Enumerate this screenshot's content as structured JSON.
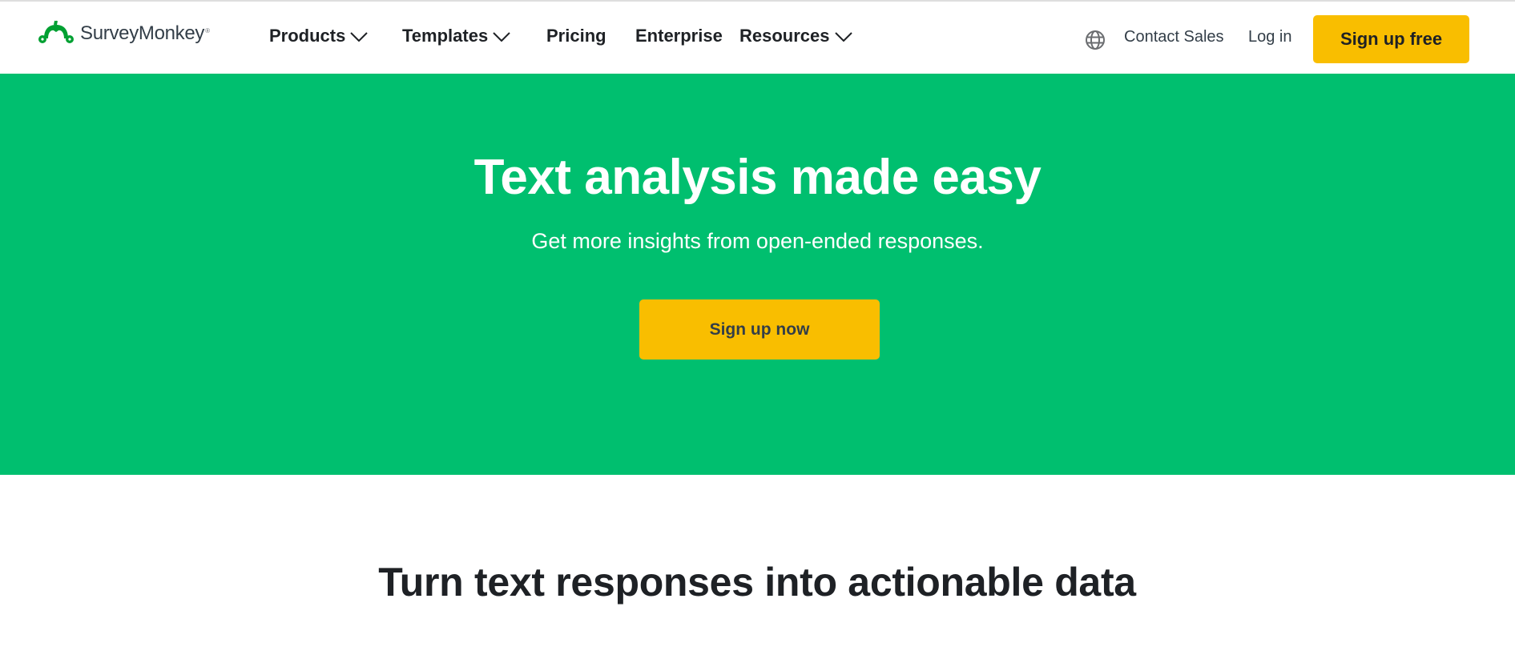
{
  "brand": {
    "name": "SurveyMonkey",
    "registered_mark": "®",
    "logo_icon": "monkey-head-icon",
    "colors": {
      "brand_green": "#00bf6f",
      "logo_green": "#00a032",
      "cta_yellow": "#f9be00",
      "text_dark": "#1e2125"
    }
  },
  "nav": {
    "items": [
      {
        "label": "Products",
        "has_dropdown": true
      },
      {
        "label": "Templates",
        "has_dropdown": true
      },
      {
        "label": "Pricing",
        "has_dropdown": false
      },
      {
        "label": "Enterprise",
        "has_dropdown": false
      },
      {
        "label": "Resources",
        "has_dropdown": true
      }
    ],
    "language_icon": "globe-icon",
    "contact_sales": "Contact Sales",
    "login": "Log in",
    "signup": "Sign up free"
  },
  "hero": {
    "title": "Text analysis made easy",
    "subtitle": "Get more insights from open-ended responses.",
    "cta": "Sign up now"
  },
  "section": {
    "title": "Turn text responses into actionable data"
  }
}
